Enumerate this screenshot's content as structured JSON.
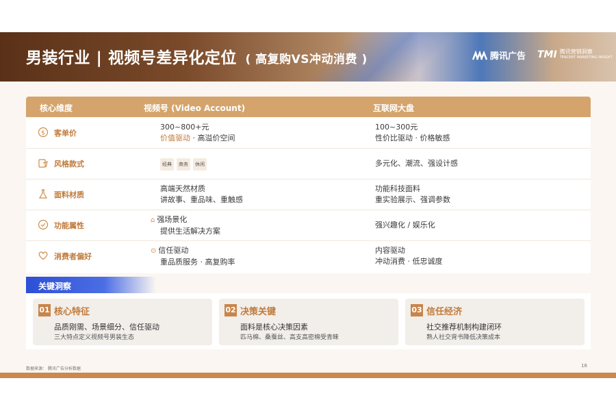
{
  "header": {
    "title": "男装行业 | 视频号差异化定位",
    "subtitle": "( 高复购VS冲动消费 )",
    "logo_tencent_ads": "腾讯广告",
    "logo_tmi": "TMI",
    "logo_tmi_cn": "腾讯营销洞察",
    "logo_tmi_en": "TENCENT MARKETING INSIGHT"
  },
  "table": {
    "headers": [
      "核心维度",
      "视频号 (Video Account)",
      "互联网大盘"
    ],
    "rows": [
      {
        "icon": "dollar-icon",
        "label": "客单价",
        "video_line1": "300~800+元",
        "video_line2_a": "价值驱动",
        "video_line2_b": " · 高溢价空间",
        "market_line1": "100~300元",
        "market_line2": "性价比驱动 · 价格敏感"
      },
      {
        "icon": "style-icon",
        "label": "风格款式",
        "tags": [
          "经典",
          "商务",
          "休闲"
        ],
        "market_line1": "多元化、潮流、强设计感"
      },
      {
        "icon": "flask-icon",
        "label": "面料材质",
        "video_line1": "高端天然材质",
        "video_line2": "讲故事、重品味、重触感",
        "market_line1": "功能科技面料",
        "market_line2": "重实验展示、强调参数"
      },
      {
        "icon": "check-icon",
        "label": "功能属性",
        "video_line1": "强场景化",
        "video_line2": "提供生活解决方案",
        "market_line1": "强兴趣化 / 娱乐化"
      },
      {
        "icon": "heart-icon",
        "label": "消费者偏好",
        "video_line1": "信任驱动",
        "video_line2": "重品质服务 · 高复购率",
        "market_line1": "内容驱动",
        "market_line2": "冲动消费 · 低忠诚度"
      }
    ]
  },
  "insights": {
    "title": "关键洞察",
    "cards": [
      {
        "num": "01",
        "title": "核心特征",
        "main": "品质刚需、场景细分、信任驱动",
        "sub": "三大特点定义视频号男装生态"
      },
      {
        "num": "02",
        "title": "决策关键",
        "main": "面料是核心决策因素",
        "sub": "匹马棉、桑蚕丝、高支高密棉受青睐"
      },
      {
        "num": "03",
        "title": "信任经济",
        "main": "社交推荐机制构建闭环",
        "sub": "熟人社交背书降低决策成本"
      }
    ]
  },
  "footer": {
    "source": "数据来源： 腾讯广告分析数据",
    "page": "16"
  },
  "colors": {
    "accent": "#c07a3a",
    "header_bar": "#d4a46c",
    "insight_blue": "#2d4fd6",
    "bottom_bar": "#c9894f"
  }
}
